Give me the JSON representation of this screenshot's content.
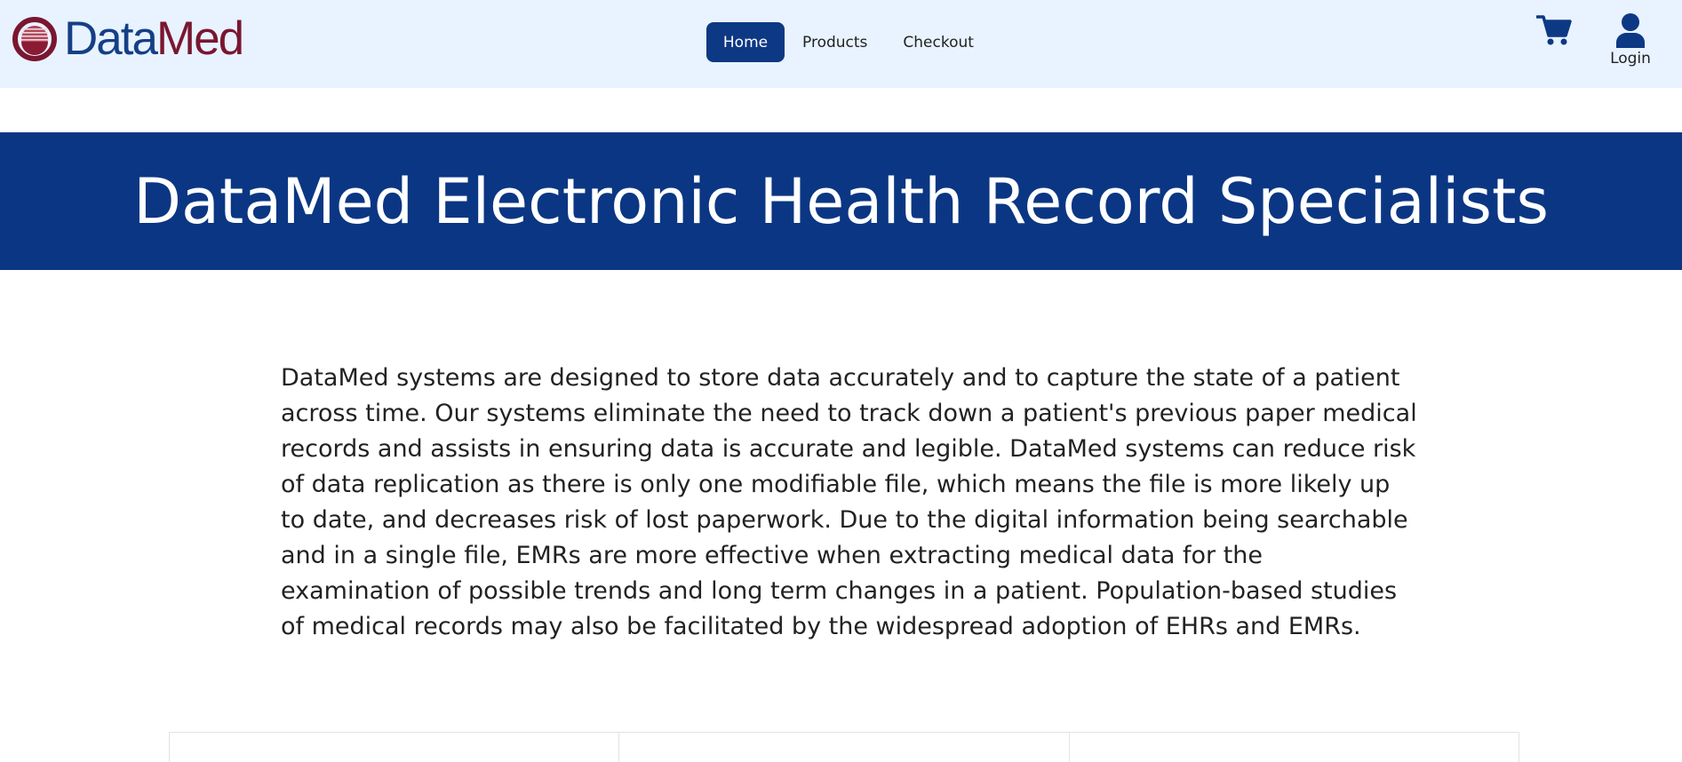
{
  "brand": {
    "name_part1": "Data",
    "name_part2": "Med",
    "logo_icon": "datamed-logo-icon",
    "colors": {
      "blue": "#153f86",
      "red": "#7a1630"
    }
  },
  "nav": {
    "items": [
      {
        "label": "Home",
        "active": true
      },
      {
        "label": "Products",
        "active": false
      },
      {
        "label": "Checkout",
        "active": false
      }
    ],
    "cart_icon": "cart-icon",
    "login_icon": "user-icon",
    "login_label": "Login"
  },
  "hero": {
    "title": "DataMed Electronic Health Record Specialists",
    "background": "#0b3683"
  },
  "intro": {
    "text": "DataMed systems are designed to store data accurately and to capture the state of a patient across time. Our systems eliminate the need to track down a patient's previous paper medical records and assists in ensuring data is accurate and legible. DataMed systems can reduce risk of data replication as there is only one modifiable file, which means the file is more likely up to date, and decreases risk of lost paperwork. Due to the digital information being searchable and in a single file, EMRs are more effective when extracting medical data for the examination of possible trends and long term changes in a patient. Population-based studies of medical records may also be facilitated by the widespread adoption of EHRs and EMRs."
  },
  "colors": {
    "navbar_bg": "#e8f3ff",
    "accent": "#0d3884"
  }
}
